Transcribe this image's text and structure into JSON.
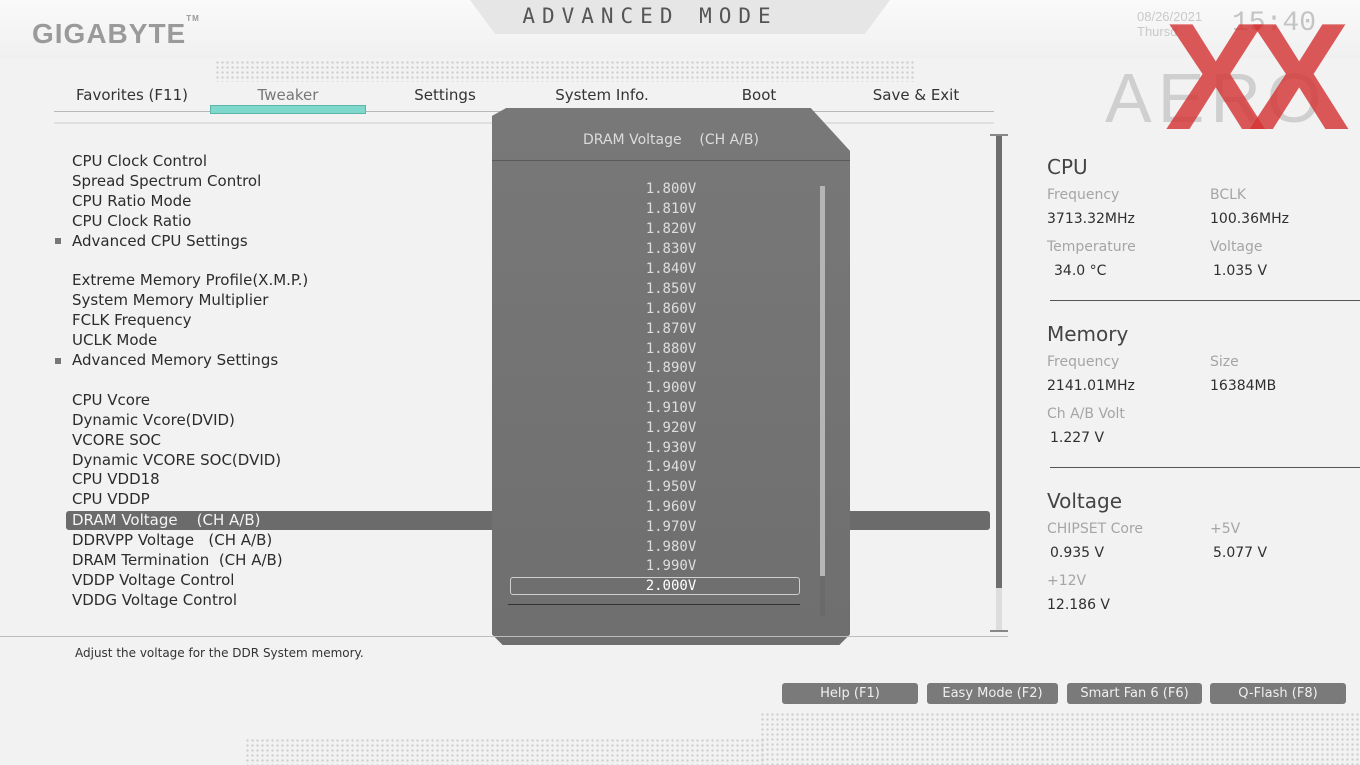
{
  "header": {
    "brand": "GIGABYTE",
    "brand_tm": "TM",
    "mode_title": "ADVANCED MODE",
    "date": "08/26/2021",
    "weekday": "Thursd",
    "time": "15:40",
    "product": "AERO",
    "watermark": "XX"
  },
  "tabs": [
    {
      "label": "Favorites (F11)"
    },
    {
      "label": "Tweaker"
    },
    {
      "label": "Settings"
    },
    {
      "label": "System Info."
    },
    {
      "label": "Boot"
    },
    {
      "label": "Save & Exit"
    }
  ],
  "menu": [
    {
      "label": "CPU Clock Control"
    },
    {
      "label": "Spread Spectrum Control"
    },
    {
      "label": "CPU Ratio Mode"
    },
    {
      "label": "CPU Clock Ratio"
    },
    {
      "label": "Advanced CPU Settings"
    },
    {
      "label": "Extreme Memory Profile(X.M.P.)"
    },
    {
      "label": "System Memory Multiplier"
    },
    {
      "label": "FCLK Frequency"
    },
    {
      "label": "UCLK Mode"
    },
    {
      "label": "Advanced Memory Settings"
    },
    {
      "label": "CPU Vcore"
    },
    {
      "label": "Dynamic Vcore(DVID)"
    },
    {
      "label": "VCORE SOC"
    },
    {
      "label": "Dynamic VCORE SOC(DVID)"
    },
    {
      "label": "CPU VDD18"
    },
    {
      "label": "CPU VDDP"
    },
    {
      "label": "DRAM Voltage    (CH A/B)"
    },
    {
      "label": "DDRVPP Voltage   (CH A/B)"
    },
    {
      "label": "DRAM Termination  (CH A/B)"
    },
    {
      "label": "VDDP Voltage Control"
    },
    {
      "label": "VDDG Voltage Control"
    }
  ],
  "popup": {
    "title": "DRAM Voltage    (CH A/B)",
    "options": [
      "1.800V",
      "1.810V",
      "1.820V",
      "1.830V",
      "1.840V",
      "1.850V",
      "1.860V",
      "1.870V",
      "1.880V",
      "1.890V",
      "1.900V",
      "1.910V",
      "1.920V",
      "1.930V",
      "1.940V",
      "1.950V",
      "1.960V",
      "1.970V",
      "1.980V",
      "1.990V",
      "2.000V"
    ],
    "selected": "2.000V"
  },
  "help_text": "Adjust the voltage for the DDR System memory.",
  "function_buttons": [
    {
      "label": "Help (F1)"
    },
    {
      "label": "Easy Mode (F2)"
    },
    {
      "label": "Smart Fan 6 (F6)"
    },
    {
      "label": "Q-Flash (F8)"
    }
  ],
  "right_panel": {
    "cpu": {
      "title": "CPU",
      "frequency_label": "Frequency",
      "frequency_value": "3713.32MHz",
      "bclk_label": "BCLK",
      "bclk_value": "100.36MHz",
      "temperature_label": "Temperature",
      "temperature_value": "34.0 °C",
      "voltage_label": "Voltage",
      "voltage_value": "1.035 V"
    },
    "memory": {
      "title": "Memory",
      "frequency_label": "Frequency",
      "frequency_value": "2141.01MHz",
      "size_label": "Size",
      "size_value": "16384MB",
      "chab_label": "Ch A/B Volt",
      "chab_value": "1.227 V"
    },
    "voltage": {
      "title": "Voltage",
      "chipset_label": "CHIPSET Core",
      "chipset_value": "0.935 V",
      "p5v_label": "+5V",
      "p5v_value": "5.077 V",
      "p12v_label": "+12V",
      "p12v_value": "12.186 V"
    }
  },
  "colors": {
    "accent_tab": "#7fd8cc",
    "highlight": "#6b6b6b",
    "watermark": "#d43535"
  }
}
